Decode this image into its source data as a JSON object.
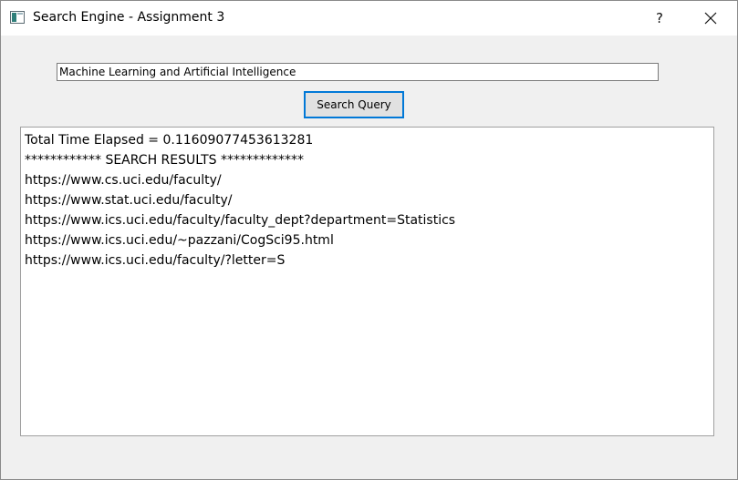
{
  "window": {
    "title": "Search Engine - Assignment 3",
    "help_label": "?"
  },
  "search": {
    "query": "Machine Learning and Artificial Intelligence",
    "button_label": "Search Query"
  },
  "results": {
    "time_line": "Total Time Elapsed = 0.11609077453613281",
    "header_line": "************  SEARCH RESULTS   *************",
    "urls": [
      "https://www.cs.uci.edu/faculty/",
      "https://www.stat.uci.edu/faculty/",
      "https://www.ics.uci.edu/faculty/faculty_dept?department=Statistics",
      "https://www.ics.uci.edu/~pazzani/CogSci95.html",
      "https://www.ics.uci.edu/faculty/?letter=S"
    ]
  }
}
